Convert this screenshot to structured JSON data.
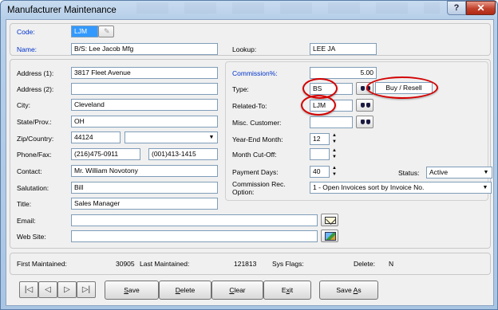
{
  "window": {
    "title": "Manufacturer Maintenance",
    "help_label": "?",
    "close_label": "✕"
  },
  "code": {
    "label": "Code:",
    "value": "LJM"
  },
  "name": {
    "label": "Name:",
    "value": "B/S: Lee Jacob Mfg"
  },
  "lookup": {
    "label": "Lookup:",
    "value": "LEE JA"
  },
  "address1": {
    "label": "Address (1):",
    "value": "3817 Fleet Avenue"
  },
  "address2": {
    "label": "Address (2):",
    "value": ""
  },
  "city": {
    "label": "City:",
    "value": "Cleveland"
  },
  "state": {
    "label": "State/Prov.:",
    "value": "OH"
  },
  "zip": {
    "label": "Zip/Country:",
    "value": "44124",
    "country": ""
  },
  "phone": {
    "label": "Phone/Fax:",
    "phone": "(216)475-0911",
    "fax": "(001)413-1415"
  },
  "contact": {
    "label": "Contact:",
    "value": "Mr. William Novotony"
  },
  "salutation": {
    "label": "Salutation:",
    "value": "Bill"
  },
  "title_field": {
    "label": "Title:",
    "value": "Sales Manager"
  },
  "email": {
    "label": "Email:",
    "value": ""
  },
  "website": {
    "label": "Web Site:",
    "value": ""
  },
  "commission": {
    "label": "Commission%:",
    "value": "5.00"
  },
  "type": {
    "label": "Type:",
    "value": "BS",
    "description": "Buy / Resell"
  },
  "related_to": {
    "label": "Related-To:",
    "value": "LJM"
  },
  "misc_customer": {
    "label": "Misc. Customer:",
    "value": ""
  },
  "year_end_month": {
    "label": "Year-End Month:",
    "value": "12"
  },
  "month_cutoff": {
    "label": "Month Cut-Off:",
    "value": ""
  },
  "payment_days": {
    "label": "Payment Days:",
    "value": "40"
  },
  "status": {
    "label": "Status:",
    "value": "Active"
  },
  "commission_rec": {
    "label_line1": "Commission Rec.",
    "label_line2": "Option:",
    "value": "1 - Open Invoices sort by Invoice No."
  },
  "footer": {
    "first_maintained_label": "First Maintained:",
    "first_maintained_value": "30905",
    "last_maintained_label": "Last Maintained:",
    "last_maintained_value": "121813",
    "sys_flags_label": "Sys Flags:",
    "sys_flags_value": "",
    "delete_label": "Delete:",
    "delete_value": "N"
  },
  "nav": {
    "first": "|◁",
    "prev": "◁",
    "next": "▷",
    "last": "▷|"
  },
  "actions": {
    "save_u": "S",
    "save_rest": "ave",
    "delete_u": "D",
    "delete_rest": "elete",
    "clear_u": "C",
    "clear_rest": "lear",
    "exit_pre": "E",
    "exit_u": "x",
    "exit_rest": "it",
    "saveas_pre": "Save ",
    "saveas_u": "A",
    "saveas_rest": "s"
  },
  "colors": {
    "annotation": "#d40000",
    "label_blue": "#0033cc",
    "selection": "#3399ff"
  }
}
